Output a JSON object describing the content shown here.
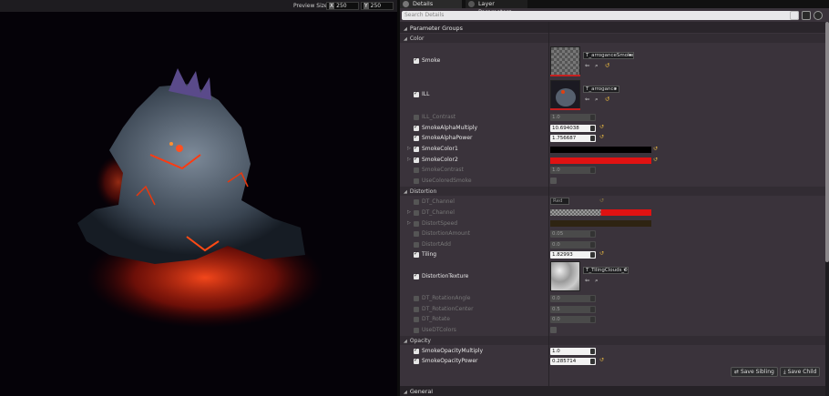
{
  "viewport": {
    "preview_size_label": "Preview Size",
    "x_label": "X",
    "x_value": "250",
    "y_label": "Y",
    "y_value": "250"
  },
  "tabs": [
    {
      "label": "Details"
    },
    {
      "label": "Layer Parameters"
    }
  ],
  "search": {
    "placeholder": "Search Details"
  },
  "section_title": "Parameter Groups",
  "groups": {
    "color": "Color",
    "distortion": "Distortion",
    "opacity": "Opacity",
    "general": "General"
  },
  "params": {
    "smoke": {
      "label": "Smoke",
      "asset": "T_arroganceSmoke"
    },
    "ill": {
      "label": "ILL",
      "asset": "T_arrogance"
    },
    "ill_contrast": {
      "label": "ILL_Contrast",
      "value": "1.0"
    },
    "smoke_alpha_multiply": {
      "label": "SmokeAlphaMultiply",
      "value": "10.694038"
    },
    "smoke_alpha_power": {
      "label": "SmokeAlphaPower",
      "value": "1.756687"
    },
    "smoke_color1": {
      "label": "SmokeColor1",
      "color": "#000000"
    },
    "smoke_color2": {
      "label": "SmokeColor2",
      "color": "#e01212"
    },
    "smoke_contrast": {
      "label": "SmokeContrast",
      "value": "1.0"
    },
    "use_colored_smoke": {
      "label": "UseColoredSmoke"
    },
    "dt_channel_1": {
      "label": "DT_Channel",
      "value": "Red"
    },
    "dt_channel_2": {
      "label": "DT_Channel"
    },
    "distort_speed": {
      "label": "DistortSpeed"
    },
    "distortion_amount": {
      "label": "DistortionAmount",
      "value": "0.05"
    },
    "distort_add": {
      "label": "DistortAdd",
      "value": "0.0"
    },
    "tiling": {
      "label": "Tiling",
      "value": "1.82993"
    },
    "distortion_texture": {
      "label": "DistortionTexture",
      "asset": "T_TilingClouds_01"
    },
    "dt_rotation_angle": {
      "label": "DT_RotationAngle",
      "value": "0.0"
    },
    "dt_rotation_center": {
      "label": "DT_RotationCenter",
      "value": "0.5"
    },
    "dt_rotate": {
      "label": "DT_Rotate",
      "value": "0.0"
    },
    "use_dt_colors": {
      "label": "UseDTColors"
    },
    "smoke_opacity_multiply": {
      "label": "SmokeOpacityMultiply",
      "value": "1.0"
    },
    "smoke_opacity_power": {
      "label": "SmokeOpacityPower",
      "value": "0.285714"
    }
  },
  "buttons": {
    "save_sibling": "Save Sibling",
    "save_child": "Save Child"
  },
  "colors": {
    "panel_bg": "#3a333b",
    "accent_reset": "#e6b640",
    "smoke_color2": "#e01212"
  }
}
